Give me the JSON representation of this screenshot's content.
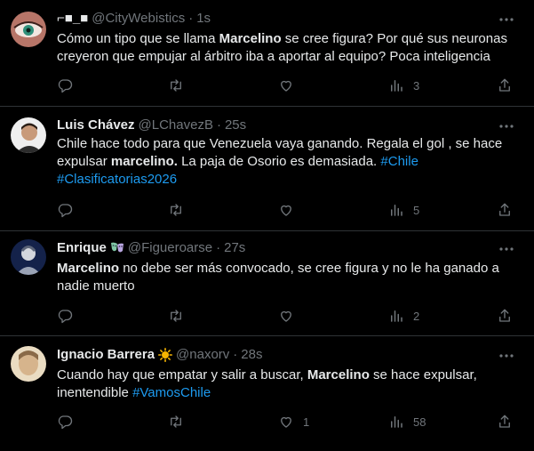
{
  "tweets": [
    {
      "name": "⌐■_■",
      "handle": "@CityWebistics",
      "time": "1s",
      "segments": [
        {
          "t": "Cómo un tipo que se llama "
        },
        {
          "t": "Marcelino",
          "bold": true
        },
        {
          "t": " se cree figura? Por qué sus neuronas creyeron que empujar al árbitro iba a aportar al equipo? Poca inteligencia"
        }
      ],
      "likes": "",
      "views": "3",
      "avatar_colors": [
        "#c48478",
        "#2f8f7a"
      ]
    },
    {
      "name": "Luis Chávez",
      "handle": "@LChavezB",
      "time": "25s",
      "segments": [
        {
          "t": "Chile hace todo para que Venezuela vaya ganando. Regala el gol , se hace expulsar "
        },
        {
          "t": "marcelino.",
          "bold": true
        },
        {
          "t": " La paja de Osorio es demasiada. "
        },
        {
          "t": "#Chile",
          "tag": true
        },
        {
          "t": " "
        },
        {
          "t": "#Clasificatorias2026",
          "tag": true
        }
      ],
      "likes": "",
      "views": "5",
      "avatar_colors": [
        "#e9e9e9",
        "#3a3028"
      ]
    },
    {
      "name": "Enrique",
      "handle": "@Figueroarse",
      "time": "27s",
      "segments": [
        {
          "t": "Marcelino",
          "bold": true
        },
        {
          "t": " no debe ser más convocado, se cree figura y no le ha ganado a nadie muerto"
        }
      ],
      "likes": "",
      "views": "2",
      "avatar_colors": [
        "#1c2a55",
        "#cfcfcf"
      ]
    },
    {
      "name": "Ignacio Barrera",
      "handle": "@naxorv",
      "time": "28s",
      "segments": [
        {
          "t": "Cuando hay que empatar y salir a buscar, "
        },
        {
          "t": "Marcelino",
          "bold": true
        },
        {
          "t": " se hace expulsar, inentendible "
        },
        {
          "t": "#VamosChile",
          "tag": true
        }
      ],
      "likes": "1",
      "views": "58",
      "avatar_colors": [
        "#e3c9a0",
        "#caa57a"
      ]
    }
  ],
  "colors": {
    "background": "#000000",
    "text": "#e7e9ea",
    "muted": "#71767b",
    "link": "#1d9bf0",
    "divider": "#2f3336"
  }
}
